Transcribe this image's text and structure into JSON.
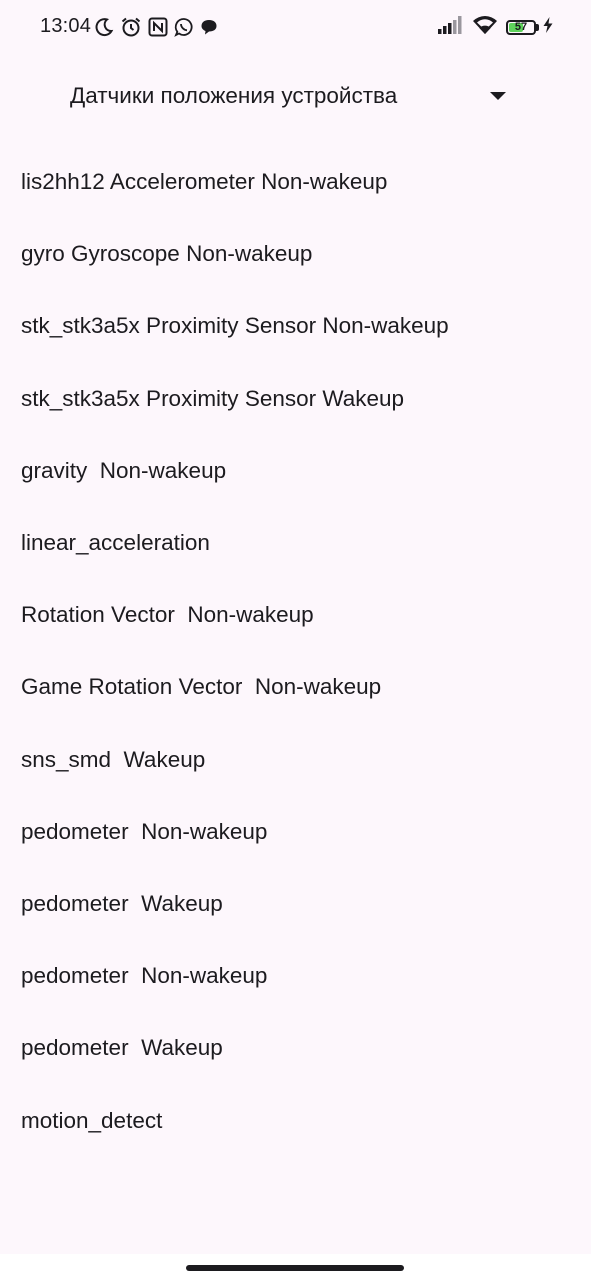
{
  "status_bar": {
    "time": "13:04",
    "left_icons": [
      "moon-icon",
      "alarm-icon",
      "nfc-icon",
      "whatsapp-icon",
      "chat-bubble-icon"
    ],
    "right_icons": [
      "signal-icon",
      "wifi-icon",
      "battery-icon",
      "charging-bolt-icon"
    ],
    "battery_level": "57",
    "battery_fraction": 0.57,
    "battery_color": "#5FD35C"
  },
  "spinner": {
    "selected": "Датчики положения устройства"
  },
  "sensors": [
    "lis2hh12 Accelerometer Non-wakeup",
    "gyro Gyroscope Non-wakeup",
    "stk_stk3a5x Proximity Sensor Non-wakeup",
    "stk_stk3a5x Proximity Sensor Wakeup",
    "gravity  Non-wakeup",
    "linear_acceleration",
    "Rotation Vector  Non-wakeup",
    "Game Rotation Vector  Non-wakeup",
    "sns_smd  Wakeup",
    "pedometer  Non-wakeup",
    "pedometer  Wakeup",
    "pedometer  Non-wakeup",
    "pedometer  Wakeup",
    "motion_detect"
  ],
  "colors": {
    "background": "#FDF7FC",
    "text": "#1C1B1F"
  }
}
